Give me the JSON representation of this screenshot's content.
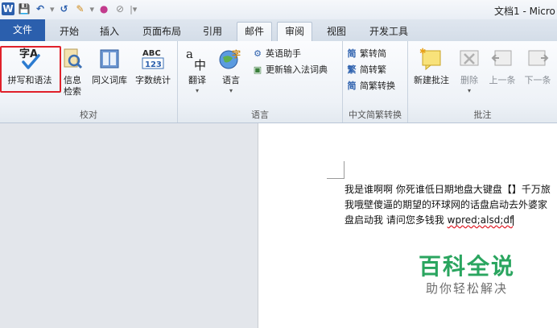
{
  "titlebar": {
    "doc_title": "文档1 - Micro",
    "qat_icons": [
      "word-logo-icon",
      "save-icon",
      "undo-icon",
      "redo-icon",
      "format-painter-icon",
      "color-icon",
      "eraser-icon"
    ],
    "word_logo_letter": "W"
  },
  "tabs": [
    {
      "label": "文件"
    },
    {
      "label": "开始"
    },
    {
      "label": "插入"
    },
    {
      "label": "页面布局"
    },
    {
      "label": "引用"
    },
    {
      "label": "邮件"
    },
    {
      "label": "审阅"
    },
    {
      "label": "视图"
    },
    {
      "label": "开发工具"
    }
  ],
  "ribbon": {
    "proofing": {
      "label": "校对",
      "spelling": "拼写和语法",
      "research": "信息检索",
      "research_line1": "信息",
      "research_line2": "检索",
      "thesaurus": "同义词库",
      "word_count": "字数统计",
      "word_count_icon_text": "ABC 123",
      "abc": "ABC",
      "num": "123",
      "spelling_glyph": "字A"
    },
    "language": {
      "label": "语言",
      "translate": "翻译",
      "language": "语言",
      "english_assistant": "英语助手",
      "update_ime": "更新输入法词典",
      "translate_glyph_a": "a",
      "translate_glyph_zh": "中",
      "lang_glyph": "字"
    },
    "chinese_conversion": {
      "label": "中文简繁转换",
      "to_simplified": "繁转简",
      "to_traditional": "简转繁",
      "conversion": "简繁转换",
      "g1": "简",
      "g2": "繁",
      "g3": "简"
    },
    "comments": {
      "label": "批注",
      "new_comment": "新建批注",
      "delete": "删除",
      "previous": "上一条",
      "next": "下一条"
    }
  },
  "document": {
    "line1": "我是谁啊啊 你死谁低日期地盘大键盘【】千万旅",
    "line2": "我哦壁傻逼的期望的环球网的话盘启动去外婆家",
    "line3_text": "盘启动我 请问您多钱我 ",
    "line3_misspelled": "wpred;alsd;d",
    "caret_char": "f"
  },
  "watermark": {
    "title": "百科全说",
    "subtitle": "助你轻松解决"
  },
  "colors": {
    "file_tab": "#2b5fad",
    "highlight_box": "#e0202a",
    "watermark_green": "#2aa55f"
  }
}
